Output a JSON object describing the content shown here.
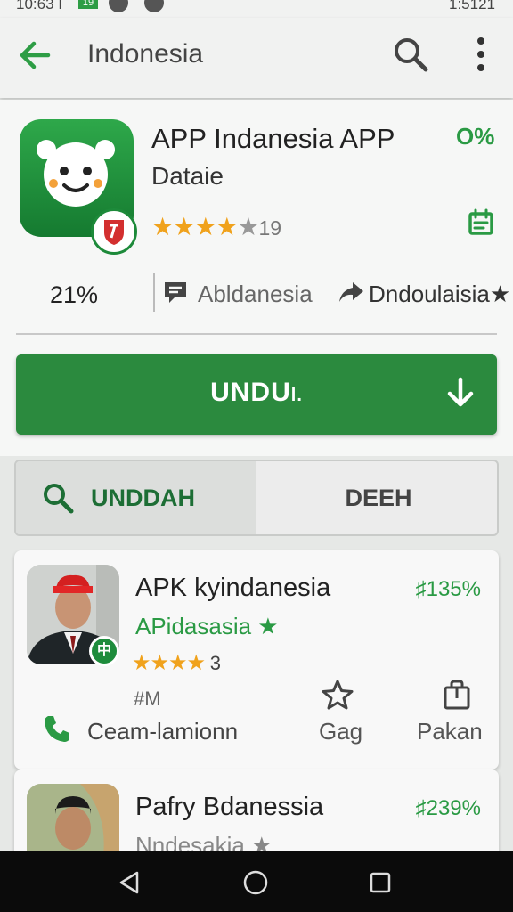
{
  "status_bar": {
    "time": "10:63 I",
    "badge": "19",
    "right": "1:5121"
  },
  "app_bar": {
    "title": "Indonesia",
    "icons": [
      "arrow-left-icon",
      "search-icon",
      "more-vert-icon"
    ]
  },
  "app": {
    "name": "APP Indanesia APP",
    "subtitle": "Dataie",
    "stars": "★★★★",
    "half_star": "★",
    "rating_count": "19",
    "badge_pct": "O%",
    "stats": {
      "percent": "21%",
      "comment_label": "Abldanesia",
      "share_label": "Dndoulaisia★"
    },
    "install_label": "UNDU",
    "install_suffix": "l.",
    "accent_color": "#2b8a3e"
  },
  "tabs": [
    {
      "label": "UNDDAH",
      "active": true
    },
    {
      "label": "DEEH",
      "active": false
    }
  ],
  "cards": [
    {
      "title": "APK kyindanesia",
      "subtitle": "APidasasia ★",
      "percent": "♯135%",
      "stars": "★★★★",
      "rating": "3",
      "meta": "#M",
      "badge": "中",
      "actions": {
        "call": "Ceam-lamionn",
        "star": "Gag",
        "bag": "Pakan"
      }
    },
    {
      "title": "Pafry Bdanessia",
      "subtitle": "Nndesakia ★",
      "percent": "♯239%"
    }
  ],
  "nav": [
    "back-triangle-icon",
    "home-circle-icon",
    "recents-square-icon"
  ]
}
